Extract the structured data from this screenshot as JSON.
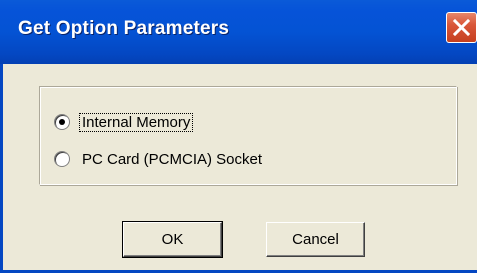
{
  "dialog": {
    "title": "Get Option Parameters",
    "close_icon": "close-x-icon"
  },
  "options": [
    {
      "label": "Internal Memory",
      "selected": true
    },
    {
      "label": "PC Card (PCMCIA) Socket",
      "selected": false
    }
  ],
  "buttons": {
    "ok_label": "OK",
    "cancel_label": "Cancel"
  },
  "colors": {
    "titlebar": "#0453d4",
    "close_button": "#d9573a",
    "dialog_background": "#ece9d8"
  }
}
